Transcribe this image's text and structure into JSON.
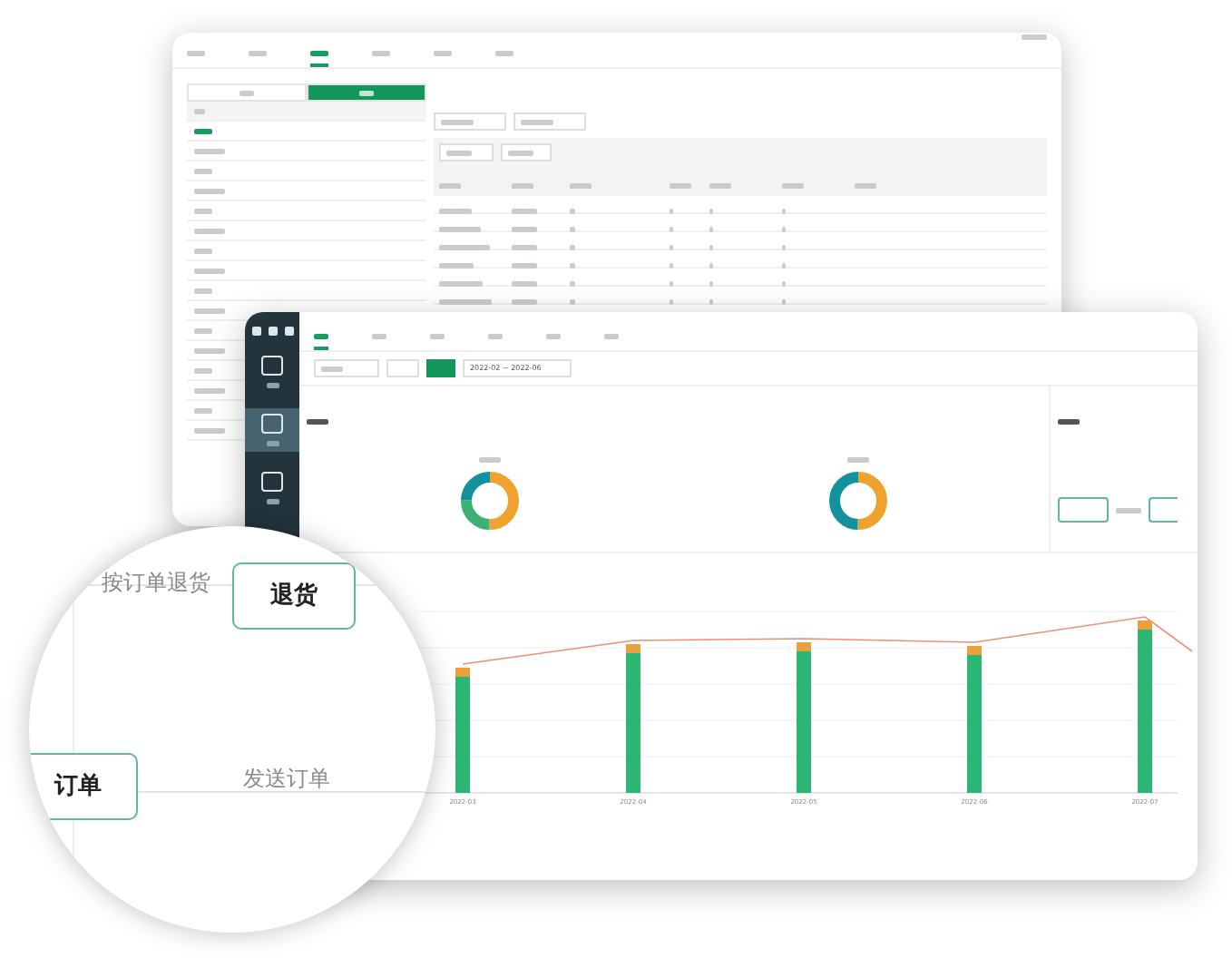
{
  "back_window": {
    "tabs": [
      {
        "selected": false
      },
      {
        "selected": false
      },
      {
        "selected": true
      },
      {
        "selected": false
      },
      {
        "selected": false
      },
      {
        "selected": false
      }
    ],
    "segments": [
      {
        "selected": false
      },
      {
        "selected": true
      }
    ]
  },
  "front_window": {
    "tabs": [
      {
        "selected": true
      },
      {
        "selected": false
      },
      {
        "selected": false
      },
      {
        "selected": false
      },
      {
        "selected": false
      },
      {
        "selected": false
      }
    ],
    "sidebar": [
      {
        "selected": false
      },
      {
        "selected": true
      },
      {
        "selected": false
      }
    ],
    "date_range": "2022-02 ~ 2022-06",
    "chart_xlabels": [
      "2022-03",
      "2022-04",
      "2022-05",
      "2022-06",
      "2022-07"
    ]
  },
  "magnifier": {
    "nodes": [
      {
        "label": "退货"
      },
      {
        "label": "订单"
      }
    ],
    "edges": [
      {
        "label": "按订单退货"
      },
      {
        "label": "发送订单"
      }
    ]
  }
}
